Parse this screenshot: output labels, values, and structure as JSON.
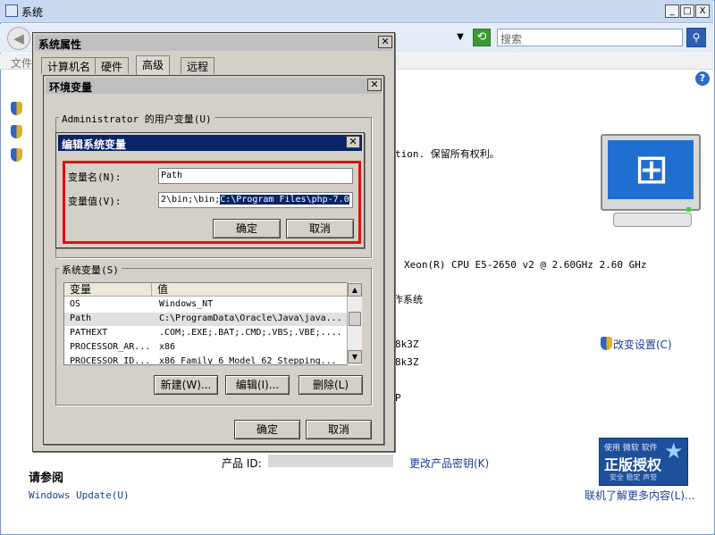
{
  "main_window": {
    "title": "系统",
    "search_placeholder": "搜索",
    "menu_file": "文件",
    "buttons": {
      "minimize": "_",
      "maximize": "□",
      "close": "X"
    },
    "help": "?",
    "copyright_text": "tion. 保留所有权利。",
    "cpu_text": "Xeon(R) CPU E5-2650 v2 @ 2.60GHz   2.60 GHz",
    "os_type_text": "作系统",
    "row1_text": "8k3Z",
    "row2_text": "8k3Z",
    "row3_text": "P",
    "change_settings_link": "改变设置(C)",
    "product_id_label": "产品 ID:",
    "change_key_link": "更改产品密钥(K)",
    "see_also_heading": "请参阅",
    "windows_update_link": "Windows Update(U)",
    "learn_more_link": "联机了解更多内容(L)...",
    "genuine_badge": {
      "top": "使用 微软 软件",
      "main": "正版授权",
      "sub": "安全 稳定 声誉"
    }
  },
  "system_properties": {
    "title": "系统属性",
    "tabs": [
      "计算机名",
      "硬件",
      "高级",
      "远程"
    ],
    "active_tab": "高级"
  },
  "env_vars": {
    "title": "环境变量",
    "user_group_label": "Administrator 的用户变量(U)",
    "system_group_label": "系统变量(S)",
    "columns": [
      "变量",
      "值"
    ],
    "rows": [
      {
        "name": "OS",
        "value": "Windows_NT"
      },
      {
        "name": "Path",
        "value": "C:\\ProgramData\\Oracle\\Java\\java..."
      },
      {
        "name": "PATHEXT",
        "value": ".COM;.EXE;.BAT;.CMD;.VBS;.VBE;...."
      },
      {
        "name": "PROCESSOR_AR...",
        "value": "x86"
      },
      {
        "name": "PROCESSOR_ID...",
        "value": "x86 Family 6 Model 62 Stepping..."
      }
    ],
    "selected_row": "Path",
    "new_button": "新建(W)...",
    "edit_button": "编辑(I)...",
    "delete_button": "删除(L)",
    "ok_button": "确定",
    "cancel_button": "取消"
  },
  "edit_dialog": {
    "title": "编辑系统变量",
    "name_label": "变量名(N):",
    "name_value": "Path",
    "value_label": "变量值(V):",
    "value_prefix": "2\\bin;\\bin;",
    "value_selected": "C:\\Program Files\\php-7.0",
    "ok_button": "确定",
    "cancel_button": "取消",
    "highlight_color": "#e01010"
  }
}
